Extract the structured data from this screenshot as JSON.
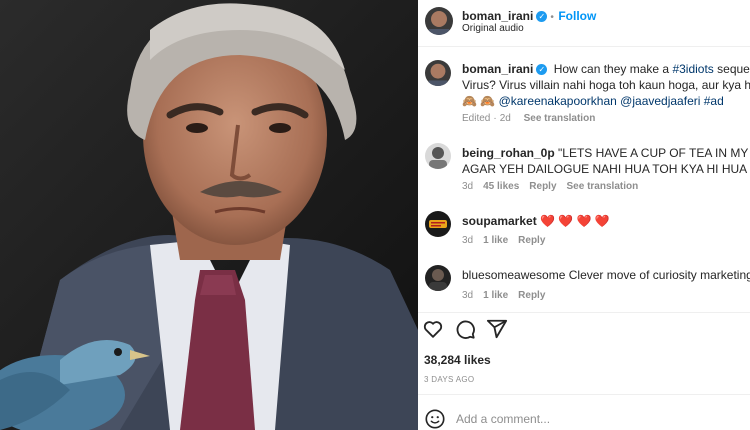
{
  "header": {
    "username": "boman_irani",
    "separator": "•",
    "follow_label": "Follow",
    "subtitle": "Original audio"
  },
  "caption": {
    "username": "boman_irani",
    "text_start": "How can they make a ",
    "hashtag_1": "#3idiots",
    "text_mid": " sequel wit",
    "line2": "Virus? Virus villain nahi hoga toh kaun hoga, aur kya hi ho",
    "emojis": "🙈 🙈",
    "mention_1": "@kareenakapoorkhan",
    "mention_2": "@jaavedjaaferi",
    "hashtag_2": "#ad",
    "edited": "Edited",
    "age": "2d",
    "see_translation": "See translation"
  },
  "comments": [
    {
      "username": "being_rohan_0p",
      "text_line1": "\"LETS HAVE A CUP OF TEA IN MY OFFIC",
      "text_line2": "AGAR YEH DAILOGUE NAHI HUA TOH KYA HI HUA FILM M",
      "age": "3d",
      "likes": "45 likes",
      "reply": "Reply",
      "see_translation": "See translation"
    },
    {
      "username": "soupamarket",
      "text_line1": "❤️ ❤️ ❤️ ❤️",
      "age": "3d",
      "likes": "1 like",
      "reply": "Reply"
    },
    {
      "username": "bluesomeawesome",
      "text_line1": "Clever move of curiosity marketing",
      "age": "3d",
      "likes": "1 like",
      "reply": "Reply"
    }
  ],
  "actions": {
    "like_icon": "heart-icon",
    "comment_icon": "comment-icon",
    "share_icon": "share-icon",
    "likes_count": "38,284 likes",
    "posted_ago": "3 DAYS AGO"
  },
  "add_comment": {
    "emoji_icon": "emoji-icon",
    "placeholder": "Add a comment..."
  },
  "colors": {
    "link": "#00376b",
    "follow": "#0095f6",
    "verified": "#1d9bf0",
    "heart": "#ed4956",
    "muted": "#8e8e8e"
  }
}
